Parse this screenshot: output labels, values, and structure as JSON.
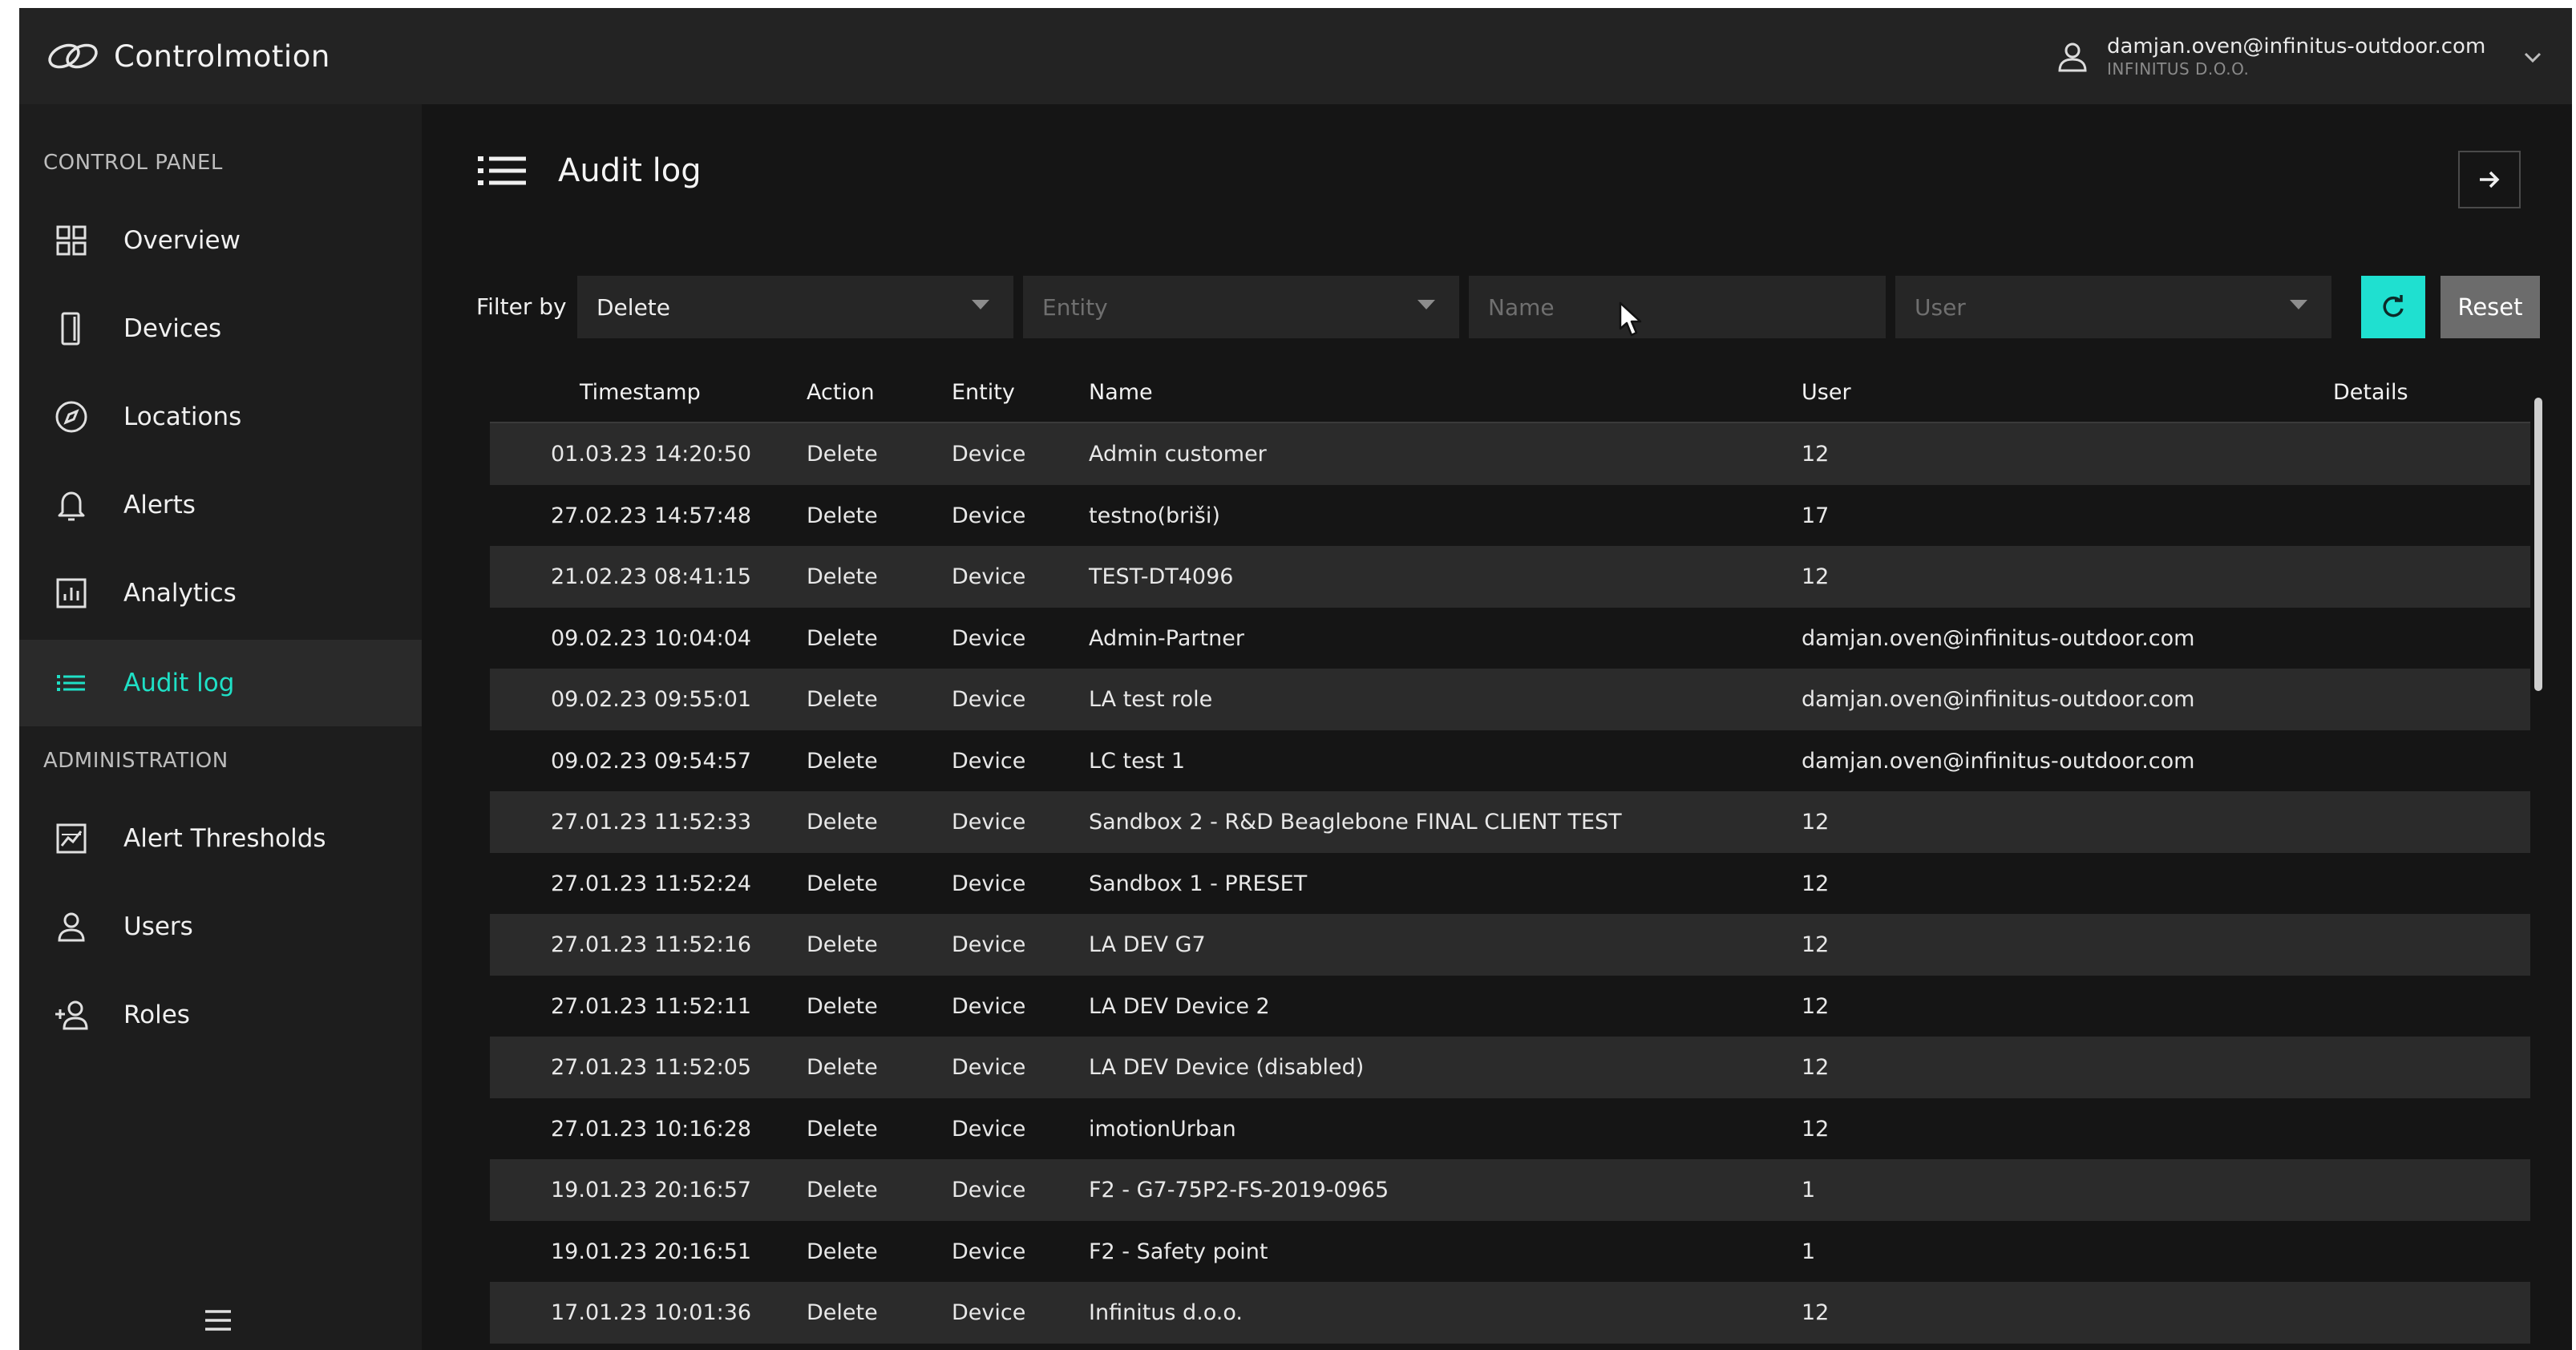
{
  "app": {
    "name": "Controlmotion",
    "account_email": "damjan.oven@infinitus-outdoor.com",
    "account_company": "INFINITUS D.O.O.",
    "accent_color": "#1fe0c6"
  },
  "sidebar": {
    "control_panel_label": "CONTROL PANEL",
    "administration_label": "ADMINISTRATION",
    "control_items": [
      {
        "label": "Overview",
        "icon": "grid-icon"
      },
      {
        "label": "Devices",
        "icon": "device-icon"
      },
      {
        "label": "Locations",
        "icon": "compass-icon"
      },
      {
        "label": "Alerts",
        "icon": "bell-icon"
      },
      {
        "label": "Analytics",
        "icon": "chart-icon"
      },
      {
        "label": "Audit log",
        "icon": "list-icon",
        "active": true
      }
    ],
    "admin_items": [
      {
        "label": "Alert Thresholds",
        "icon": "threshold-chart-icon"
      },
      {
        "label": "Users",
        "icon": "user-icon"
      },
      {
        "label": "Roles",
        "icon": "add-user-icon"
      }
    ]
  },
  "page": {
    "title": "Audit log"
  },
  "filters": {
    "label": "Filter by",
    "action_value": "Delete",
    "entity_placeholder": "Entity",
    "name_placeholder": "Name",
    "user_placeholder": "User",
    "reset_label": "Reset"
  },
  "table": {
    "columns": [
      "Timestamp",
      "Action",
      "Entity",
      "Name",
      "User",
      "Details"
    ],
    "rows": [
      {
        "timestamp": "01.03.23 14:20:50",
        "action": "Delete",
        "entity": "Device",
        "name": "Admin customer",
        "user": "12"
      },
      {
        "timestamp": "27.02.23 14:57:48",
        "action": "Delete",
        "entity": "Device",
        "name": "testno(briši)",
        "user": "17"
      },
      {
        "timestamp": "21.02.23 08:41:15",
        "action": "Delete",
        "entity": "Device",
        "name": "TEST-DT4096",
        "user": "12"
      },
      {
        "timestamp": "09.02.23 10:04:04",
        "action": "Delete",
        "entity": "Device",
        "name": "Admin-Partner",
        "user": "damjan.oven@infinitus-outdoor.com"
      },
      {
        "timestamp": "09.02.23 09:55:01",
        "action": "Delete",
        "entity": "Device",
        "name": "LA test role",
        "user": "damjan.oven@infinitus-outdoor.com"
      },
      {
        "timestamp": "09.02.23 09:54:57",
        "action": "Delete",
        "entity": "Device",
        "name": "LC test 1",
        "user": "damjan.oven@infinitus-outdoor.com"
      },
      {
        "timestamp": "27.01.23 11:52:33",
        "action": "Delete",
        "entity": "Device",
        "name": "Sandbox 2 - R&D Beaglebone FINAL CLIENT TEST",
        "user": "12"
      },
      {
        "timestamp": "27.01.23 11:52:24",
        "action": "Delete",
        "entity": "Device",
        "name": "Sandbox 1 - PRESET",
        "user": "12"
      },
      {
        "timestamp": "27.01.23 11:52:16",
        "action": "Delete",
        "entity": "Device",
        "name": "LA DEV G7",
        "user": "12"
      },
      {
        "timestamp": "27.01.23 11:52:11",
        "action": "Delete",
        "entity": "Device",
        "name": "LA DEV Device 2",
        "user": "12"
      },
      {
        "timestamp": "27.01.23 11:52:05",
        "action": "Delete",
        "entity": "Device",
        "name": "LA DEV Device (disabled)",
        "user": "12"
      },
      {
        "timestamp": "27.01.23 10:16:28",
        "action": "Delete",
        "entity": "Device",
        "name": "imotionUrban",
        "user": "12"
      },
      {
        "timestamp": "19.01.23 20:16:57",
        "action": "Delete",
        "entity": "Device",
        "name": "F2 - G7-75P2-FS-2019-0965",
        "user": "1"
      },
      {
        "timestamp": "19.01.23 20:16:51",
        "action": "Delete",
        "entity": "Device",
        "name": "F2 - Safety point",
        "user": "1"
      },
      {
        "timestamp": "17.01.23 10:01:36",
        "action": "Delete",
        "entity": "Device",
        "name": "Infinitus d.o.o.",
        "user": "12"
      }
    ]
  }
}
